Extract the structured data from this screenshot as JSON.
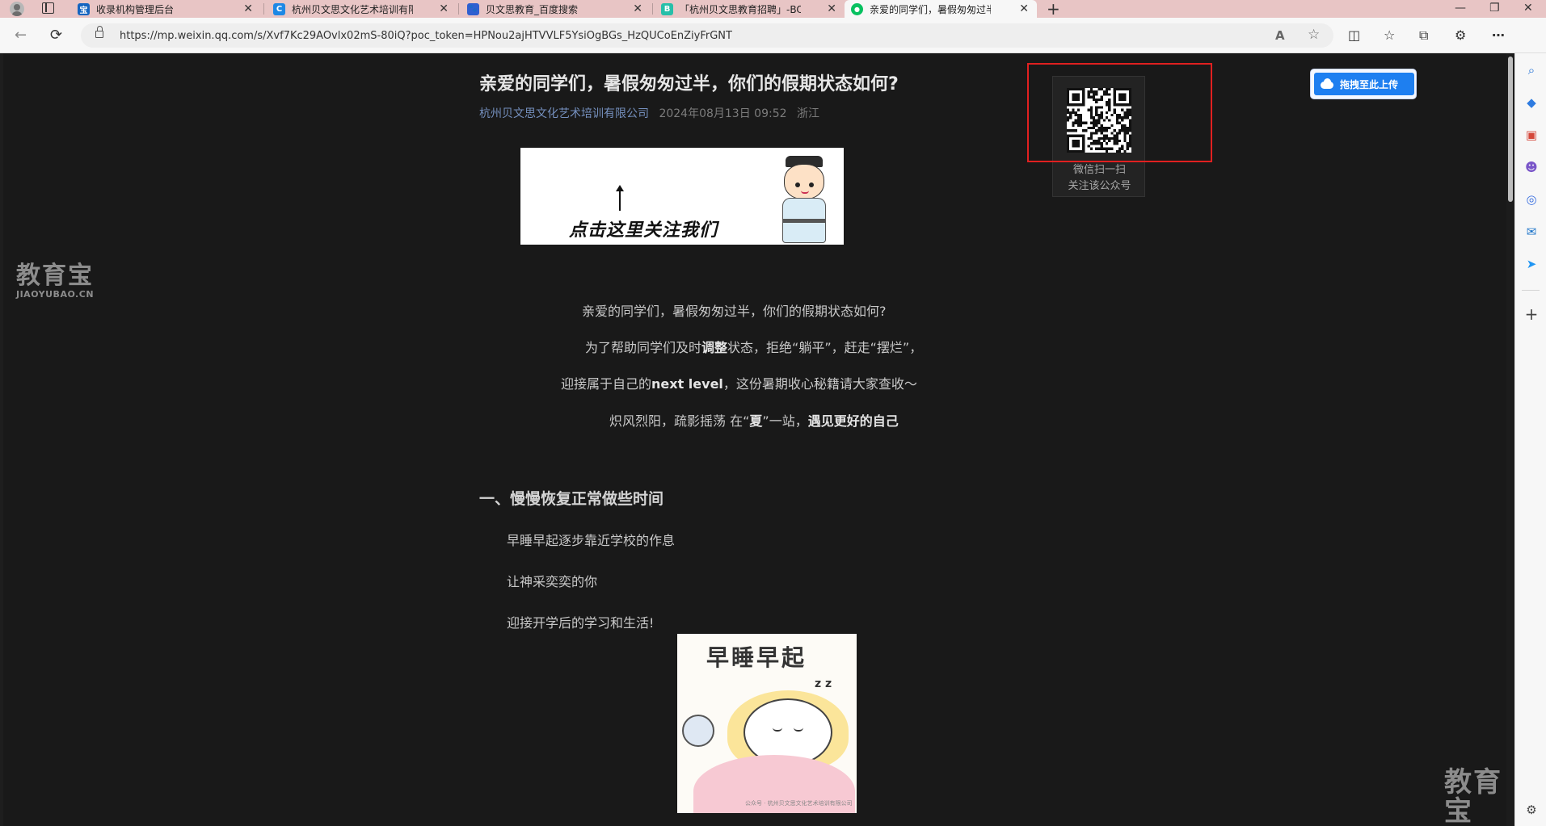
{
  "browser": {
    "tabs": [
      {
        "label": "收录机构管理后台",
        "favicon": "宝",
        "favicon_color": "#1565c0"
      },
      {
        "label": "杭州贝文思文化艺术培训有限公司",
        "favicon": "C",
        "favicon_color": "#1e88e5"
      },
      {
        "label": "贝文思教育_百度搜索",
        "favicon": "🐾",
        "favicon_color": "#2f5fd0"
      },
      {
        "label": "「杭州贝文思教育招聘」-BOSS直聘",
        "favicon": "B",
        "favicon_color": "#27bfa9"
      },
      {
        "label": "亲爱的同学们，暑假匆匆过半，你们",
        "favicon": "●",
        "favicon_color": "#07c160"
      }
    ],
    "close_glyph": "✕",
    "new_tab_glyph": "+",
    "window_controls": [
      "—",
      "❐",
      "✕"
    ],
    "url": "https://mp.weixin.qq.com/s/Xvf7Kc29AOvlx02mS-80iQ?poc_token=HPNou2ajHTVVLF5YsiOgBGs_HzQUCoEnZiyFrGNT",
    "nav": {
      "back": "←",
      "refresh": "⟳"
    },
    "omnibox_icons": {
      "read_aloud": "A",
      "favorite": "☆"
    },
    "toolbar_icons": {
      "split_screen": "◫",
      "favorites": "☆",
      "collections": "⧉",
      "extensions": "⚙",
      "more": "⋯"
    }
  },
  "article": {
    "title": "亲爱的同学们，暑假匆匆过半，你们的假期状态如何?",
    "author": "杭州贝文思文化艺术培训有限公司",
    "date": "2024年08月13日 09:52",
    "location": "浙江",
    "follow_banner_text": "点击这里关注我们",
    "paragraphs": {
      "p1": "亲爱的同学们，暑假匆匆过半，你们的假期状态如何?",
      "p2_a": "为了帮助同学们及时",
      "p2_b": "调整",
      "p2_c": "状态，拒绝“躺平”，赶走“摆烂”，",
      "p3_a": "迎接属于自己的",
      "p3_b": "next level",
      "p3_c": "，这份暑期收心秘籍请大家查收～",
      "p4_a": "炽风烈阳，疏影摇荡  在“",
      "p4_b": "夏",
      "p4_c": "”一站，",
      "p4_d": "遇见更好的自己"
    },
    "section_heading": "一、慢慢恢复正常做些时间",
    "section_lines": [
      "早睡早起逐步靠近学校的作息",
      "让神采奕奕的你",
      "迎接开学后的学习和生活!"
    ],
    "sleep_image_title": "早睡早起",
    "sleep_image_caption": "公众号 · 杭州贝文思文化艺术培训有限公司",
    "sleep_zz": "z z"
  },
  "qr": {
    "line1": "微信扫一扫",
    "line2": "关注该公众号"
  },
  "upload": {
    "label": "拖拽至此上传"
  },
  "watermark": {
    "cn": "教育宝",
    "en": "JIAOYUBAO.CN"
  },
  "sidebar": {
    "icons": [
      {
        "name": "search-icon",
        "glyph": "⌕",
        "color": "#1f6fd6"
      },
      {
        "name": "tag-icon",
        "glyph": "◆",
        "color": "#2e7be0"
      },
      {
        "name": "toolbox-icon",
        "glyph": "▣",
        "color": "#d4473a"
      },
      {
        "name": "people-icon",
        "glyph": "☻",
        "color": "#7a56c9"
      },
      {
        "name": "copilot-icon",
        "glyph": "◎",
        "color": "#3a6fe0"
      },
      {
        "name": "outlook-icon",
        "glyph": "✉",
        "color": "#1b73c9"
      },
      {
        "name": "send-icon",
        "glyph": "➤",
        "color": "#2196f3"
      }
    ],
    "add": "+",
    "settings": "⚙"
  },
  "colors": {
    "accent_blue": "#1e7ff0",
    "highlight_red": "#e02020",
    "link": "#7590be"
  }
}
